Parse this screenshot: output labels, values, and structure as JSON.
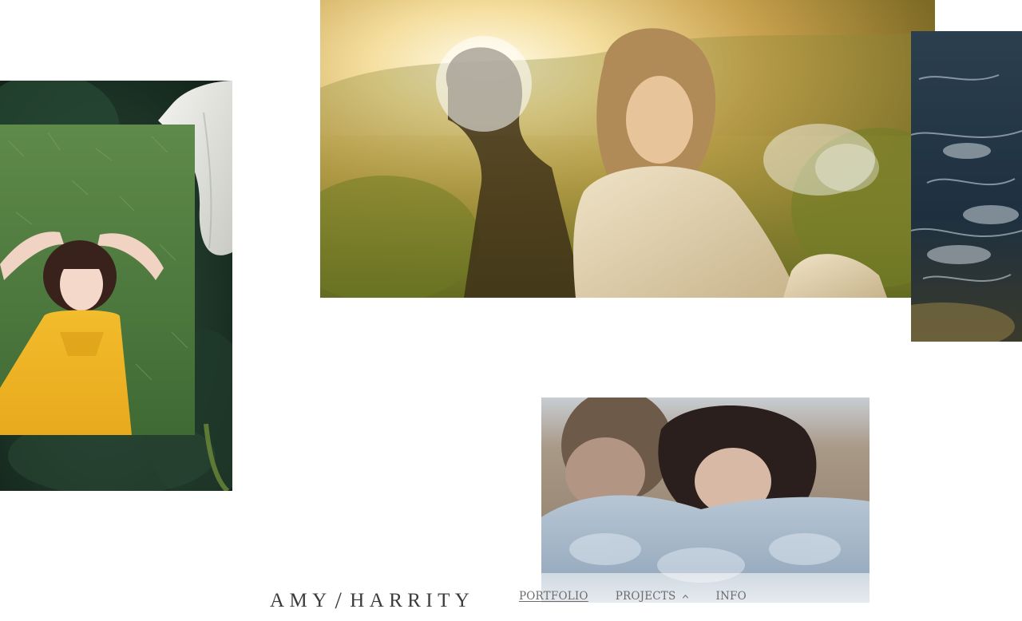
{
  "site": {
    "brand_left": "AMY",
    "brand_slash": "/",
    "brand_right": "HARRITY"
  },
  "nav": {
    "items": [
      {
        "label": "PORTFOLIO",
        "active": true
      },
      {
        "label": "PROJECTS",
        "icon": "chevron-up-icon"
      },
      {
        "label": "INFO"
      }
    ]
  },
  "colors": {
    "brand_text": "#3b3b3b",
    "nav_text": "#6b6b6b",
    "background": "#ffffff"
  },
  "photos": [
    {
      "subject": "white calla lily in dark foliage"
    },
    {
      "subject": "girl in yellow dress lying on grass"
    },
    {
      "subject": "two people in golden backlight, woman in fur coat"
    },
    {
      "subject": "ocean waves from above"
    },
    {
      "subject": "couple embracing on a beach"
    }
  ]
}
